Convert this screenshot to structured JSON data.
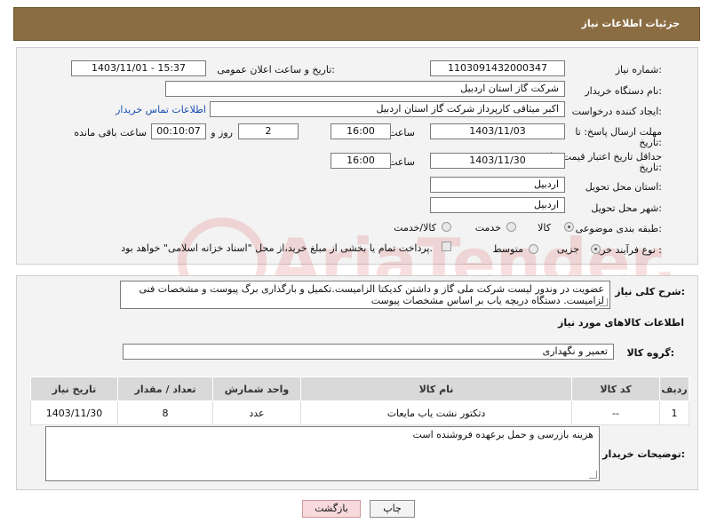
{
  "header": {
    "title": "جزئیات اطلاعات نیاز"
  },
  "form": {
    "need_number_label": "شماره نیاز:",
    "need_number": "1103091432000347",
    "announce_label": "تاریخ و ساعت اعلان عمومی:",
    "announce_value": "1403/11/01 - 15:37",
    "buyer_org_label": "نام دستگاه خریدار:",
    "buyer_org": "شرکت گاز استان اردبیل",
    "creator_label": "ایجاد کننده درخواست:",
    "creator": "اکبر میثاقی کارپرداز شرکت گاز استان اردبیل",
    "contact_link": "اطلاعات تماس خریدار",
    "reply_deadline_label_1": "مهلت ارسال پاسخ: تا",
    "reply_deadline_label_2": "تاریخ:",
    "reply_date": "1403/11/03",
    "time_label": "ساعت",
    "reply_time": "16:00",
    "days_value": "2",
    "days_label": "روز و",
    "remaining_value": "00:10:07",
    "remaining_label": "ساعت باقی مانده",
    "price_validity_label_1": "حداقل تاریخ اعتبار قیمت: تا",
    "price_validity_label_2": "تاریخ:",
    "price_date": "1403/11/30",
    "price_time": "16:00",
    "province_label": "استان محل تحویل:",
    "province": "اردبیل",
    "city_label": "شهر محل تحویل:",
    "city": "اردبیل",
    "category_label": "طبقه بندی موضوعی:",
    "category_options": [
      "کالا",
      "خدمت",
      "کالا/خدمت"
    ],
    "category_selected": "کالا",
    "process_label": "نوع فرآیند خرید :",
    "process_options": [
      "جزیی",
      "متوسط"
    ],
    "process_selected": "جزیی",
    "payment_note": "پرداخت تمام یا بخشی از مبلغ خرید،از محل \"اسناد خزانه اسلامی\" خواهد بود."
  },
  "details": {
    "description_label": "شرح کلی نیاز:",
    "description": "عضویت در وندور لیست شرکت ملی گاز و داشتن کدیکتا الزامیست.تکمیل و بارگذاری برگ پیوست و مشخصات فنی لزامیست. دستگاه دریچه یاب بر اساس مشخصات پیوست",
    "goods_info_title": "اطلاعات کالاهای مورد نیاز",
    "goods_group_label": "گروه کالا:",
    "goods_group": "تعمیر و نگهداری",
    "table": {
      "headers": [
        "ردیف",
        "کد کالا",
        "نام کالا",
        "واحد شمارش",
        "تعداد / مقدار",
        "تاریخ نیاز"
      ],
      "rows": [
        [
          "1",
          "--",
          "دتکتور نشت یاب مایعات",
          "عدد",
          "8",
          "1403/11/30"
        ]
      ]
    },
    "buyer_notes_label": "توضیحات خریدار:",
    "buyer_notes": "هزینه بازرسی و حمل برعهده فروشنده است"
  },
  "buttons": {
    "print": "چاپ",
    "back": "بازگشت"
  },
  "watermark_text": "AriaTender.neT",
  "colors": {
    "header_bg": "#8b6d43",
    "link": "#1a4fb3",
    "back_button_bg": "#f8d9dc"
  }
}
